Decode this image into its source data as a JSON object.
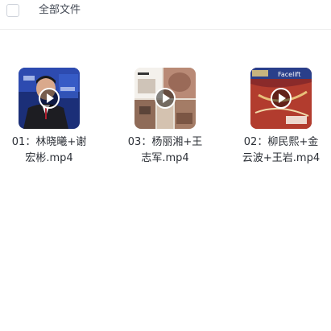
{
  "header": {
    "title": "全部文件"
  },
  "files": [
    {
      "name": "01：林晓曦+谢宏彬.mp4",
      "type_icon": "video-thumbnail",
      "overlay_icon": "play-icon"
    },
    {
      "name": "03：杨丽湘+王志军.mp4",
      "type_icon": "video-thumbnail",
      "overlay_icon": "play-icon"
    },
    {
      "name": "02：柳民熙+金云波+王岩.mp4",
      "type_icon": "video-thumbnail",
      "overlay_icon": "play-icon",
      "thumb_text": "Facelift"
    }
  ],
  "colors": {
    "header_border": "#eeeeee",
    "text": "#2b2f36",
    "thumb1_bg": "#1b2f78",
    "thumb2_bg": "#e7e0d6",
    "thumb3_bg": "#8a2a2a"
  }
}
